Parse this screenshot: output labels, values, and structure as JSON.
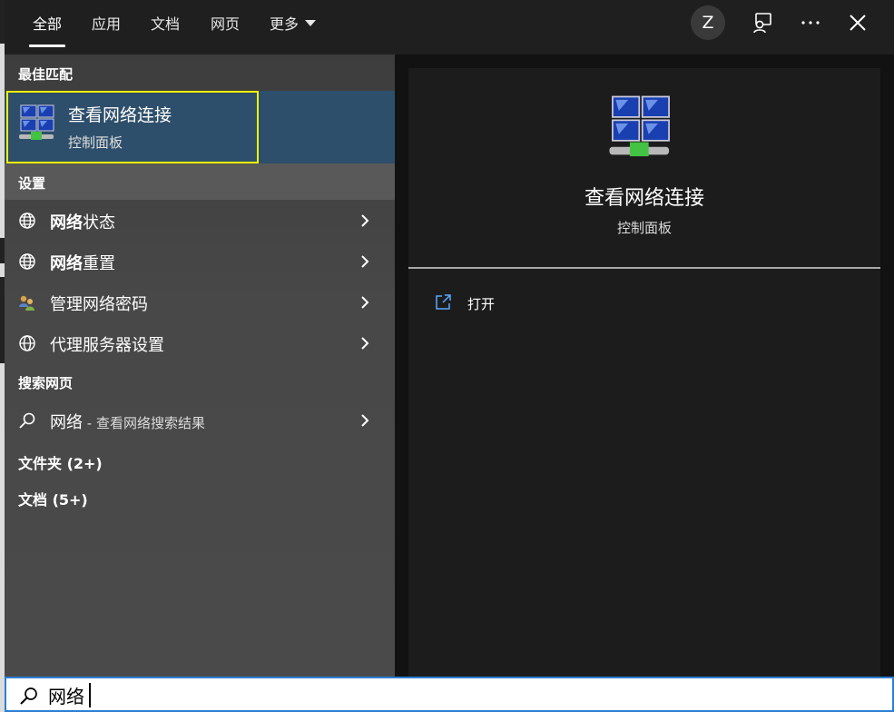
{
  "header": {
    "tabs": [
      {
        "label": "全部",
        "active": true
      },
      {
        "label": "应用"
      },
      {
        "label": "文档"
      },
      {
        "label": "网页"
      },
      {
        "label": "更多"
      }
    ],
    "avatar_initial": "Z",
    "icons": [
      "feedback-icon",
      "more-options-icon",
      "close-icon"
    ]
  },
  "best_match": {
    "heading": "最佳匹配",
    "title": "查看网络连接",
    "subtitle": "控制面板",
    "icon": "network-connections-icon"
  },
  "settings": {
    "heading": "设置",
    "items": [
      {
        "bold": "网络",
        "rest": "状态",
        "icon": "globe-icon"
      },
      {
        "bold": "网络",
        "rest": "重置",
        "icon": "globe-icon"
      },
      {
        "bold": "",
        "rest": "管理网络密码",
        "icon": "users-icon"
      },
      {
        "bold": "",
        "rest": "代理服务器设置",
        "icon": "globe-icon"
      }
    ]
  },
  "web_search": {
    "heading": "搜索网页",
    "query": "网络",
    "suffix": " - 查看网络搜索结果"
  },
  "folders_label": "文件夹 (2+)",
  "documents_label": "文档 (5+)",
  "detail": {
    "title": "查看网络连接",
    "subtitle": "控制面板",
    "actions": [
      {
        "label": "打开",
        "icon": "open-icon"
      }
    ]
  },
  "search": {
    "value": "网络"
  },
  "colors": {
    "selected_row": "#2e4f6b",
    "highlight_border": "#f4f400",
    "search_border": "#2b7fd4"
  }
}
